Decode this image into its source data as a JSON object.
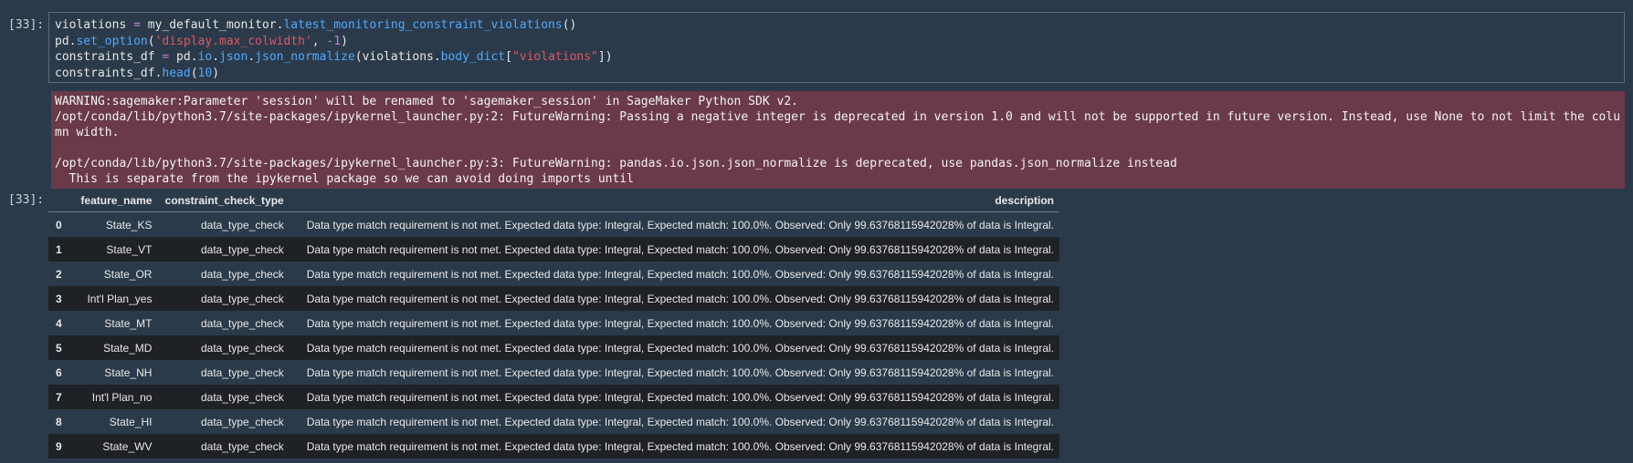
{
  "input_cell": {
    "prompt": "[33]:",
    "lines": [
      [
        {
          "t": "violations ",
          "c": ""
        },
        {
          "t": "=",
          "c": "kw"
        },
        {
          "t": " my_default_monitor.",
          "c": ""
        },
        {
          "t": "latest_monitoring_constraint_violations",
          "c": "fn"
        },
        {
          "t": "()",
          "c": ""
        }
      ],
      [
        {
          "t": "pd.",
          "c": ""
        },
        {
          "t": "set_option",
          "c": "fn"
        },
        {
          "t": "(",
          "c": ""
        },
        {
          "t": "'display.max_colwidth'",
          "c": "str"
        },
        {
          "t": ", ",
          "c": ""
        },
        {
          "t": "-1",
          "c": "kw"
        },
        {
          "t": ")",
          "c": ""
        }
      ],
      [
        {
          "t": "constraints_df ",
          "c": ""
        },
        {
          "t": "=",
          "c": "kw"
        },
        {
          "t": " pd.",
          "c": ""
        },
        {
          "t": "io",
          "c": "fn"
        },
        {
          "t": ".",
          "c": ""
        },
        {
          "t": "json",
          "c": "fn"
        },
        {
          "t": ".",
          "c": ""
        },
        {
          "t": "json_normalize",
          "c": "fn"
        },
        {
          "t": "(violations.",
          "c": ""
        },
        {
          "t": "body_dict",
          "c": "fn"
        },
        {
          "t": "[",
          "c": ""
        },
        {
          "t": "\"violations\"",
          "c": "str"
        },
        {
          "t": "])",
          "c": ""
        }
      ],
      [
        {
          "t": "constraints_df.",
          "c": ""
        },
        {
          "t": "head",
          "c": "fn"
        },
        {
          "t": "(",
          "c": ""
        },
        {
          "t": "10",
          "c": "num"
        },
        {
          "t": ")",
          "c": ""
        }
      ]
    ]
  },
  "stderr": {
    "lines": [
      "WARNING:sagemaker:Parameter 'session' will be renamed to 'sagemaker_session' in SageMaker Python SDK v2.",
      "/opt/conda/lib/python3.7/site-packages/ipykernel_launcher.py:2: FutureWarning: Passing a negative integer is deprecated in version 1.0 and will not be supported in future version. Instead, use None to not limit the colu",
      "mn width.",
      "",
      "/opt/conda/lib/python3.7/site-packages/ipykernel_launcher.py:3: FutureWarning: pandas.io.json.json_normalize is deprecated, use pandas.json_normalize instead",
      "  This is separate from the ipykernel package so we can avoid doing imports until"
    ]
  },
  "output_cell": {
    "prompt": "[33]:",
    "columns": [
      "",
      "feature_name",
      "constraint_check_type",
      "description"
    ],
    "rows": [
      [
        "0",
        "State_KS",
        "data_type_check",
        "Data type match requirement is not met. Expected data type: Integral, Expected match: 100.0%. Observed: Only 99.63768115942028% of data is Integral."
      ],
      [
        "1",
        "State_VT",
        "data_type_check",
        "Data type match requirement is not met. Expected data type: Integral, Expected match: 100.0%. Observed: Only 99.63768115942028% of data is Integral."
      ],
      [
        "2",
        "State_OR",
        "data_type_check",
        "Data type match requirement is not met. Expected data type: Integral, Expected match: 100.0%. Observed: Only 99.63768115942028% of data is Integral."
      ],
      [
        "3",
        "Int'l Plan_yes",
        "data_type_check",
        "Data type match requirement is not met. Expected data type: Integral, Expected match: 100.0%. Observed: Only 99.63768115942028% of data is Integral."
      ],
      [
        "4",
        "State_MT",
        "data_type_check",
        "Data type match requirement is not met. Expected data type: Integral, Expected match: 100.0%. Observed: Only 99.63768115942028% of data is Integral."
      ],
      [
        "5",
        "State_MD",
        "data_type_check",
        "Data type match requirement is not met. Expected data type: Integral, Expected match: 100.0%. Observed: Only 99.63768115942028% of data is Integral."
      ],
      [
        "6",
        "State_NH",
        "data_type_check",
        "Data type match requirement is not met. Expected data type: Integral, Expected match: 100.0%. Observed: Only 99.63768115942028% of data is Integral."
      ],
      [
        "7",
        "Int'l Plan_no",
        "data_type_check",
        "Data type match requirement is not met. Expected data type: Integral, Expected match: 100.0%. Observed: Only 99.63768115942028% of data is Integral."
      ],
      [
        "8",
        "State_HI",
        "data_type_check",
        "Data type match requirement is not met. Expected data type: Integral, Expected match: 100.0%. Observed: Only 99.63768115942028% of data is Integral."
      ],
      [
        "9",
        "State_WV",
        "data_type_check",
        "Data type match requirement is not met. Expected data type: Integral, Expected match: 100.0%. Observed: Only 99.63768115942028% of data is Integral."
      ]
    ]
  },
  "colors": {
    "background": "#2b3a4a",
    "stderr_background": "#6a3a48",
    "keyword": "#c678dd",
    "function": "#4fa9ff",
    "string": "#e05561"
  }
}
